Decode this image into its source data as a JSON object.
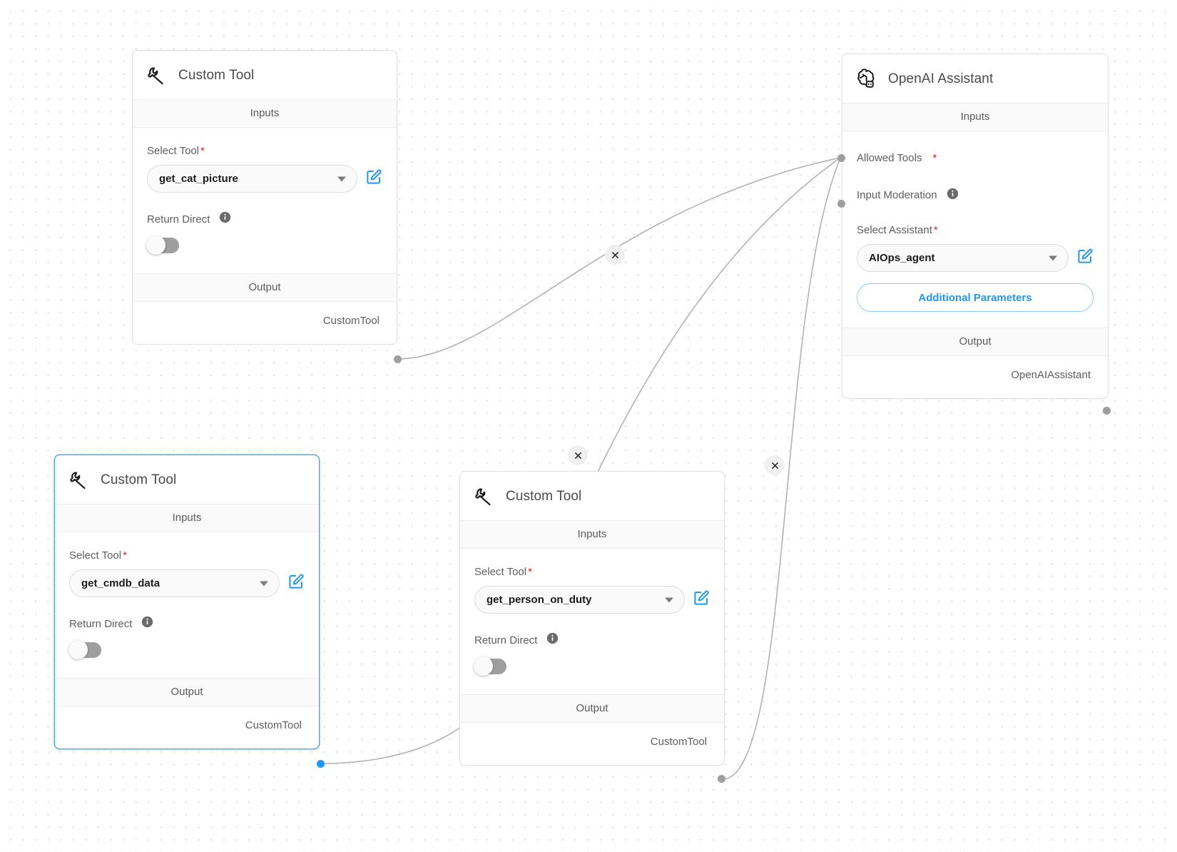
{
  "canvas": {
    "background": "#ffffff",
    "dot_color": "#d9d9de"
  },
  "colors": {
    "accent_blue": "#2196f3",
    "selected_border": "#4ea9e9",
    "required_star": "#e02020",
    "edge": "#b1b1b7",
    "handle": "#9e9e9e"
  },
  "labels": {
    "inputs": "Inputs",
    "output": "Output",
    "required_marker": "*"
  },
  "nodes": [
    {
      "id": "custom-tool-1",
      "title": "Custom Tool",
      "icon": "wrench-icon",
      "selected": false,
      "select_label": "Select Tool",
      "select_value": "get_cat_picture",
      "toggle_label": "Return Direct",
      "toggle_on": false,
      "output_label": "CustomTool"
    },
    {
      "id": "custom-tool-2",
      "title": "Custom Tool",
      "icon": "wrench-icon",
      "selected": true,
      "select_label": "Select Tool",
      "select_value": "get_cmdb_data",
      "toggle_label": "Return Direct",
      "toggle_on": false,
      "output_label": "CustomTool"
    },
    {
      "id": "custom-tool-3",
      "title": "Custom Tool",
      "icon": "wrench-icon",
      "selected": false,
      "select_label": "Select Tool",
      "select_value": "get_person_on_duty",
      "toggle_label": "Return Direct",
      "toggle_on": false,
      "output_label": "CustomTool"
    }
  ],
  "assistant_node": {
    "id": "openai-assistant",
    "title": "OpenAI Assistant",
    "icon": "openai-icon",
    "inputs": [
      {
        "label": "Allowed Tools",
        "required": true,
        "has_info": false
      },
      {
        "label": "Input Moderation",
        "required": false,
        "has_info": true
      }
    ],
    "select_label": "Select Assistant",
    "select_value": "AIOps_agent",
    "additional_params_label": "Additional Parameters",
    "output_label": "OpenAIAssistant"
  },
  "edge_buttons": [
    {
      "id": "edge-delete-1",
      "glyph": "×"
    },
    {
      "id": "edge-delete-2",
      "glyph": "×"
    },
    {
      "id": "edge-delete-3",
      "glyph": "×"
    }
  ]
}
